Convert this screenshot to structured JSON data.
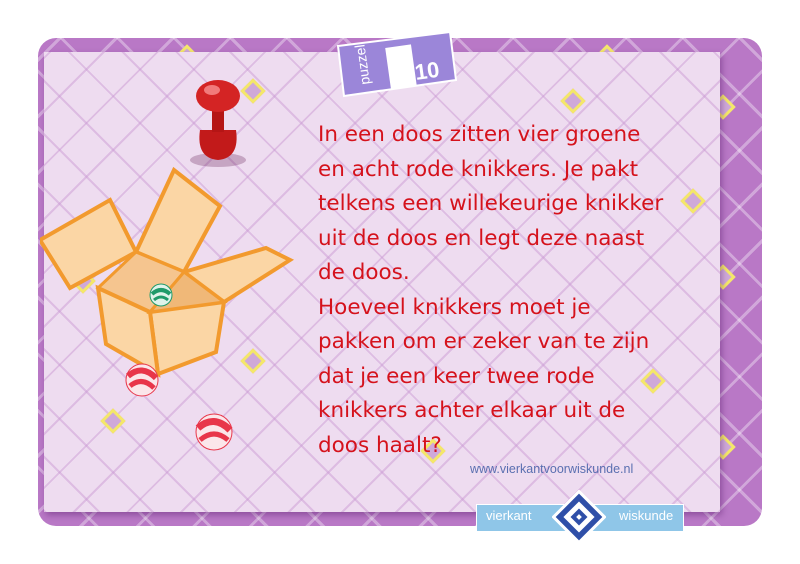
{
  "puzzle_tag": {
    "label": "puzzel",
    "number": "10"
  },
  "question": "In een doos zitten vier groene\nen acht rode knikkers. Je pakt\ntelkens een willekeurige knikker\nuit de doos en legt deze naast\nde doos.\nHoeveel knikkers moet je\npakken om er zeker van te zijn\ndat je een keer twee rode\nknikkers achter elkaar uit de\ndoos haalt?",
  "website": "www.vierkantvoorwiskunde.nl",
  "logo": {
    "left_word": "vierkant",
    "right_word": "wiskunde"
  },
  "colors": {
    "card": "#b978c6",
    "paper": "#eedcf0",
    "question_text": "#d5121c",
    "tag": "#9b86d9",
    "logo_bar": "#8fc6e8",
    "box": "#fbd6a5",
    "box_outline": "#f29a2e",
    "red_marble": "#e8364a",
    "green_marble": "#1f9a6a"
  },
  "icons": [
    "push-pin-icon",
    "cardboard-box-icon",
    "green-marble-icon",
    "red-marble-icon",
    "vierkant-logo-icon"
  ]
}
